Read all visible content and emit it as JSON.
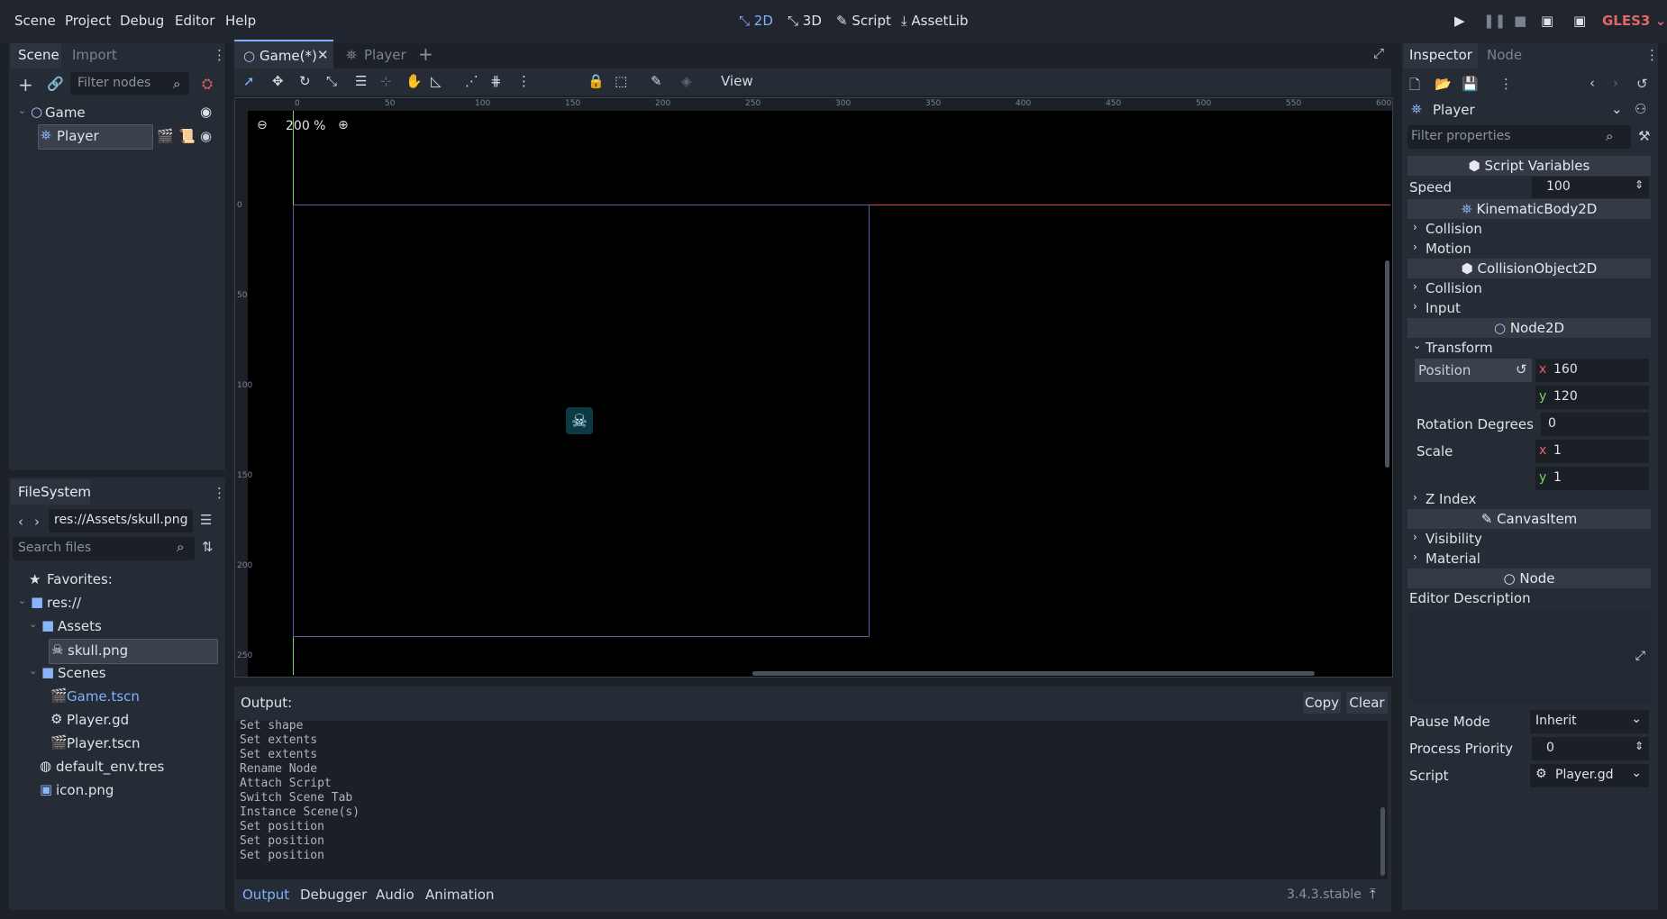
{
  "menu": [
    "Scene",
    "Project",
    "Debug",
    "Editor",
    "Help"
  ],
  "workspaces": [
    "2D",
    "3D",
    "Script",
    "AssetLib"
  ],
  "renderer": "GLES3",
  "scene_dock": {
    "tabs": [
      "Scene",
      "Import"
    ],
    "filter_placeholder": "Filter nodes",
    "nodes": [
      "Game",
      "Player"
    ]
  },
  "filesystem_dock": {
    "title": "FileSystem",
    "path": "res://Assets/skull.png",
    "search_placeholder": "Search files",
    "items": [
      "Favorites:",
      "res://",
      "Assets",
      "skull.png",
      "Scenes",
      "Game.tscn",
      "Player.gd",
      "Player.tscn",
      "default_env.tres",
      "icon.png"
    ]
  },
  "editor_tabs": [
    "Game(*)",
    "Player"
  ],
  "toolbar": {
    "view_label": "View"
  },
  "viewport": {
    "zoom": "200 %",
    "ruler_ticks": [
      "0",
      "50",
      "100",
      "150",
      "200",
      "250",
      "300",
      "350",
      "400",
      "450",
      "500",
      "550",
      "600"
    ],
    "vruler_ticks": [
      "0",
      "50",
      "100",
      "150",
      "200",
      "250"
    ]
  },
  "output": {
    "label": "Output:",
    "copy": "Copy",
    "clear": "Clear",
    "lines": [
      "Set shape",
      "Set extents",
      "Set extents",
      "Rename Node",
      "Attach Script",
      "Switch Scene Tab",
      "Instance Scene(s)",
      "Set position",
      "Set position",
      "Set position"
    ],
    "bottom_tabs": [
      "Output",
      "Debugger",
      "Audio",
      "Animation"
    ],
    "version": "3.4.3.stable"
  },
  "inspector": {
    "tabs": [
      "Inspector",
      "Node"
    ],
    "node_name": "Player",
    "filter_placeholder": "Filter properties",
    "script_variables": "Script Variables",
    "speed_label": "Speed",
    "speed_value": "100",
    "kinematic": "KinematicBody2D",
    "collision": "Collision",
    "motion": "Motion",
    "collision_object": "CollisionObject2D",
    "collision2": "Collision",
    "input": "Input",
    "node2d": "Node2D",
    "transform": "Transform",
    "position_label": "Position",
    "pos_x": "160",
    "pos_y": "120",
    "rotation_label": "Rotation Degrees",
    "rotation_value": "0",
    "scale_label": "Scale",
    "scale_x": "1",
    "scale_y": "1",
    "z_index": "Z Index",
    "canvas_item": "CanvasItem",
    "visibility": "Visibility",
    "material": "Material",
    "node": "Node",
    "editor_description": "Editor Description",
    "pause_mode_label": "Pause Mode",
    "pause_mode_value": "Inherit",
    "process_priority_label": "Process Priority",
    "process_priority_value": "0",
    "script_label": "Script",
    "script_value": "Player.gd",
    "x_axis": "x",
    "y_axis": "y"
  },
  "colors": {
    "accent": "#7fb1ff",
    "origin_x_axis": "#e0454d",
    "origin_y_axis": "#7bd36a"
  }
}
